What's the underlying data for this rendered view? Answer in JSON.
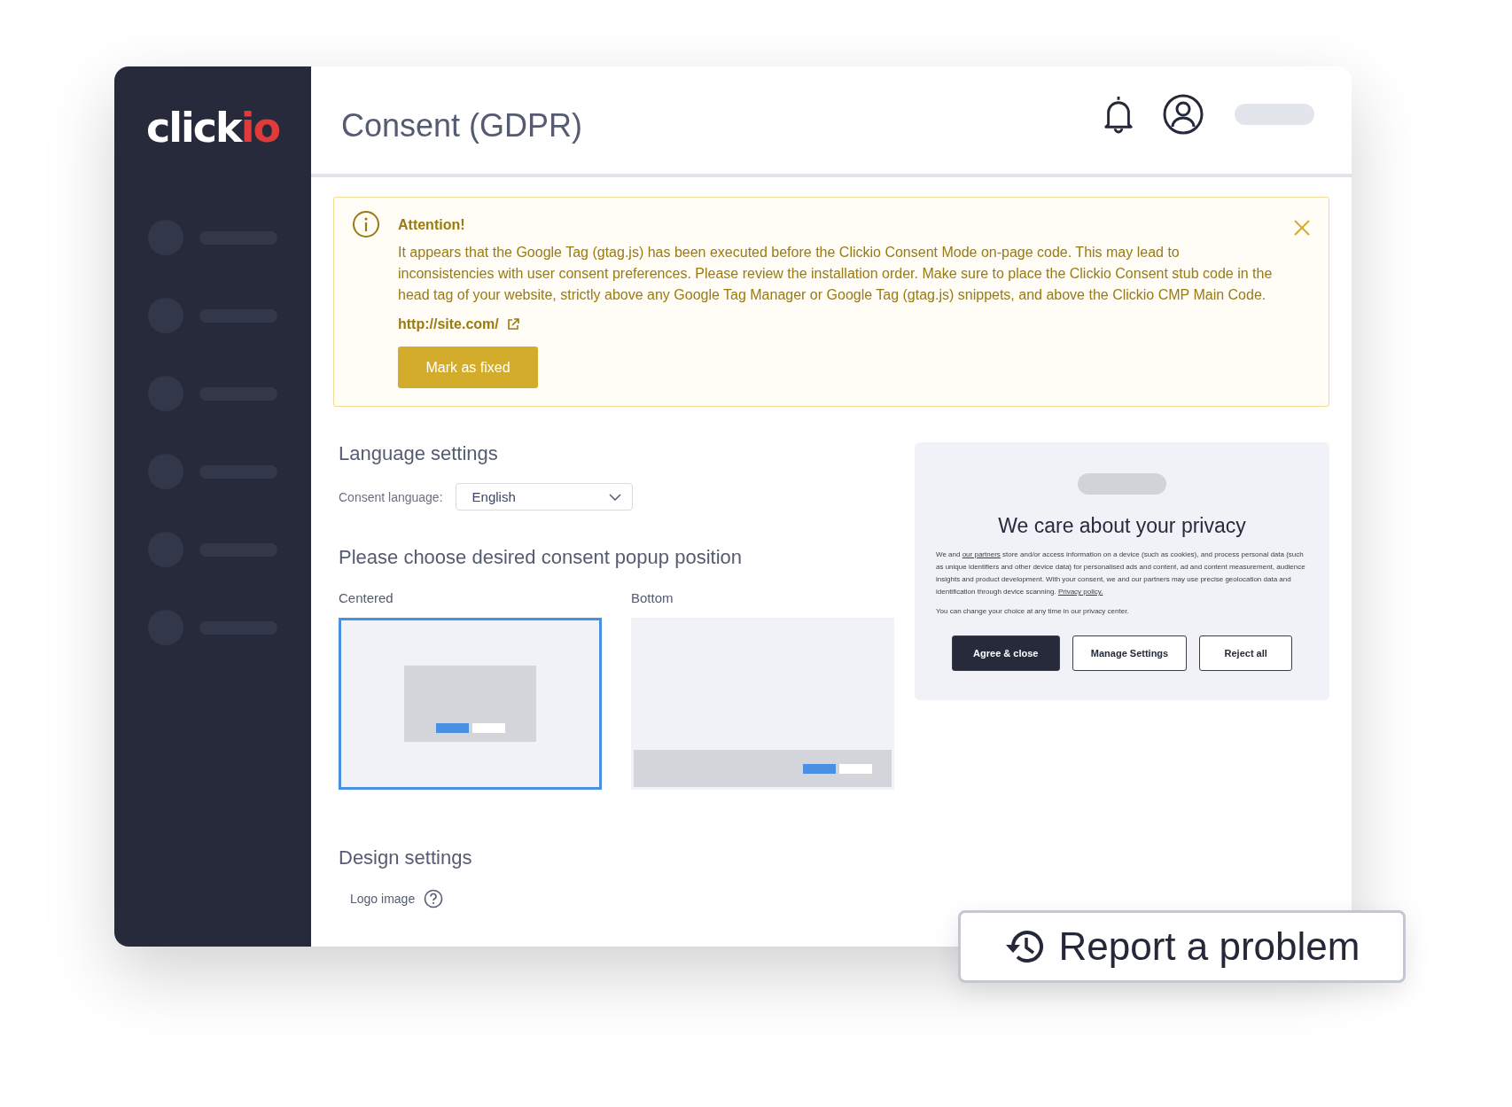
{
  "logo": {
    "parts": [
      "click",
      "io"
    ]
  },
  "sidebar": {
    "items": [
      {
        "kind": "skeleton"
      },
      {
        "kind": "skeleton"
      },
      {
        "kind": "skeleton"
      },
      {
        "kind": "skeleton"
      },
      {
        "kind": "skeleton"
      },
      {
        "kind": "skeleton"
      }
    ]
  },
  "header": {
    "title": "Consent (GDPR)"
  },
  "alert": {
    "title": "Attention!",
    "message": "It appears that the Google Tag (gtag.js) has been executed before the Clickio Consent Mode on-page code. This may lead to inconsistencies with user consent preferences. Please review the installation order. Make sure to place the Clickio Consent stub code in the head tag of your website, strictly above any Google Tag Manager or Google Tag (gtag.js) snippets, and above the Clickio CMP Main Code.",
    "link": "http://site.com/",
    "button": "Mark as fixed"
  },
  "language_settings": {
    "heading": "Language settings",
    "label": "Consent language:",
    "value": "English"
  },
  "popup_position": {
    "heading": "Please choose desired consent popup position",
    "options": [
      {
        "label": "Centered",
        "kind": "centered",
        "selected": true
      },
      {
        "label": "Bottom",
        "kind": "bottom",
        "selected": false
      }
    ]
  },
  "preview": {
    "title": "We care about your privacy",
    "paragraphs": [
      [
        {
          "text": "We and "
        },
        {
          "text": "our partners",
          "kind": "link"
        },
        {
          "text": " store and/or access information on a device (such as cookies), and process personal data (such as unique identifiers and other device data) for personalised ads and content, ad and content measurement, audience insights and product development. With your consent, we and our partners may use precise geolocation data and identification through device scanning. "
        },
        {
          "text": "Privacy policy.",
          "kind": "link"
        }
      ],
      [
        {
          "text": "You can change your choice at any time in our privacy center."
        }
      ]
    ],
    "buttons": [
      {
        "label": "Agree & close",
        "kind": "primary"
      },
      {
        "label": "Manage Settings",
        "kind": "outline"
      },
      {
        "label": "Reject all",
        "kind": "outline"
      }
    ]
  },
  "design_settings": {
    "heading": "Design settings",
    "field": "Logo image"
  },
  "report_button": "Report a problem"
}
